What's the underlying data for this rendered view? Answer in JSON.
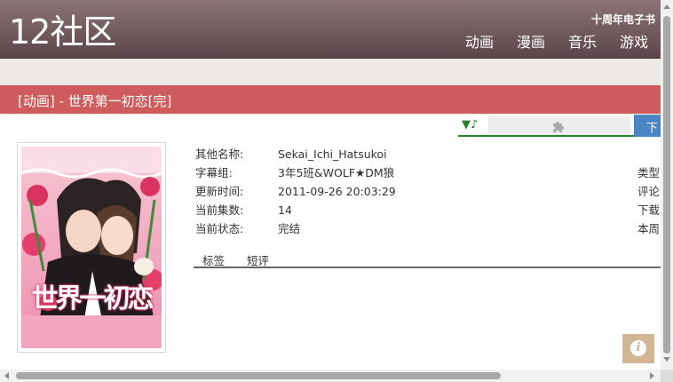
{
  "header": {
    "logo": "12社区",
    "ebook_link": "十周年电子书",
    "nav": [
      "动画",
      "漫画",
      "音乐",
      "游戏"
    ]
  },
  "title": "[动画] - 世界第一初恋[完]",
  "player": {
    "music_icon": "▼♪",
    "download_label": "下"
  },
  "details": [
    {
      "label": "其他名称:",
      "value": "Sekai_Ichi_Hatsukoi"
    },
    {
      "label": "字幕组:",
      "value": "3年5班&WOLF★DM狼"
    },
    {
      "label": "更新时间:",
      "value": "2011-09-26 20:03:29"
    },
    {
      "label": "当前集数:",
      "value": "14"
    },
    {
      "label": "当前状态:",
      "value": "完结"
    }
  ],
  "side_labels": [
    "类型",
    "评论",
    "下载",
    "本周"
  ],
  "tabs": [
    "标签",
    "短评"
  ],
  "cover_title": "世界一初恋",
  "info_button": "i",
  "colors": {
    "header": "#6f585c",
    "title_bar": "#cf5c5d",
    "band": "#ece8e5",
    "player_green": "#2a7f2a",
    "download_blue": "#4a86c4",
    "info_button": "#d2b592"
  }
}
